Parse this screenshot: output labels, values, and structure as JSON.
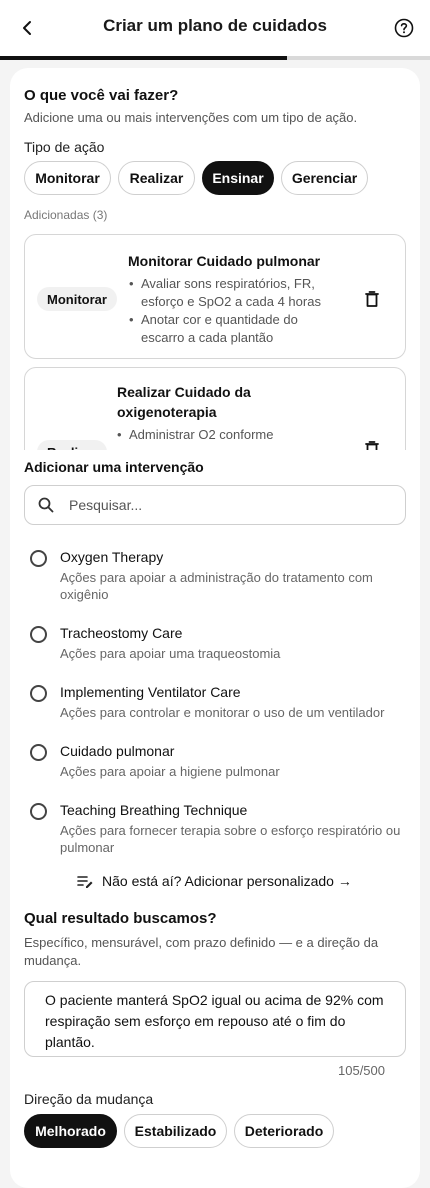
{
  "header": {
    "title": "Criar um plano de cuidados",
    "back_icon": "back-arrow-icon",
    "help_icon": "help-circle-icon",
    "progress": 0.667
  },
  "section_action": {
    "heading": "O que você vai fazer?",
    "description": "Adicione uma ou mais intervenções com um tipo de ação.",
    "type_label": "Tipo de ação",
    "types": [
      "Monitorar",
      "Realizar",
      "Ensinar",
      "Gerenciar"
    ],
    "selected_type": "Ensinar",
    "added_label": "Adicionadas (3)",
    "added": [
      {
        "tag": "Monitorar",
        "title": "Monitorar Cuidado pulmonar",
        "bullets": [
          "Avaliar sons respiratórios, FR, esforço e SpO2 a cada 4 horas",
          "Anotar cor e quantidade do escarro a cada plantão"
        ]
      },
      {
        "tag": "Realizar",
        "title": "Realizar Cuidado da oxigenoterapia",
        "bullets": [
          "Administrar O2 conforme"
        ]
      }
    ]
  },
  "section_add": {
    "heading": "Adicionar uma intervenção",
    "search_placeholder": "Pesquisar...",
    "options": [
      {
        "title": "Oxygen Therapy",
        "desc": "Ações para apoiar a administração do tratamento com oxigênio"
      },
      {
        "title": "Tracheostomy Care",
        "desc": "Ações para apoiar uma traqueostomia"
      },
      {
        "title": "Implementing Ventilator Care",
        "desc": "Ações para controlar e monitorar o uso de um ventilador"
      },
      {
        "title": "Cuidado pulmonar",
        "desc": "Ações para apoiar a higiene pulmonar"
      },
      {
        "title": "Teaching Breathing Technique",
        "desc": "Ações para fornecer terapia sobre o esforço respiratório ou pulmonar"
      }
    ],
    "custom_link": "Não está aí? Adicionar personalizado →",
    "custom_icon": "edit-list-icon"
  },
  "section_outcome": {
    "heading": "Qual resultado buscamos?",
    "description": "Específico, mensurável, com prazo definido — e a direção da mudança.",
    "value": "O paciente manterá SpO2 igual ou acima de 92% com respiração sem esforço em repouso até o fim do plantão.",
    "counter": "105/500",
    "direction_label": "Direção da mudança",
    "directions": [
      "Melhorado",
      "Estabilizado",
      "Deteriorado"
    ],
    "selected_direction": "Melhorado"
  }
}
